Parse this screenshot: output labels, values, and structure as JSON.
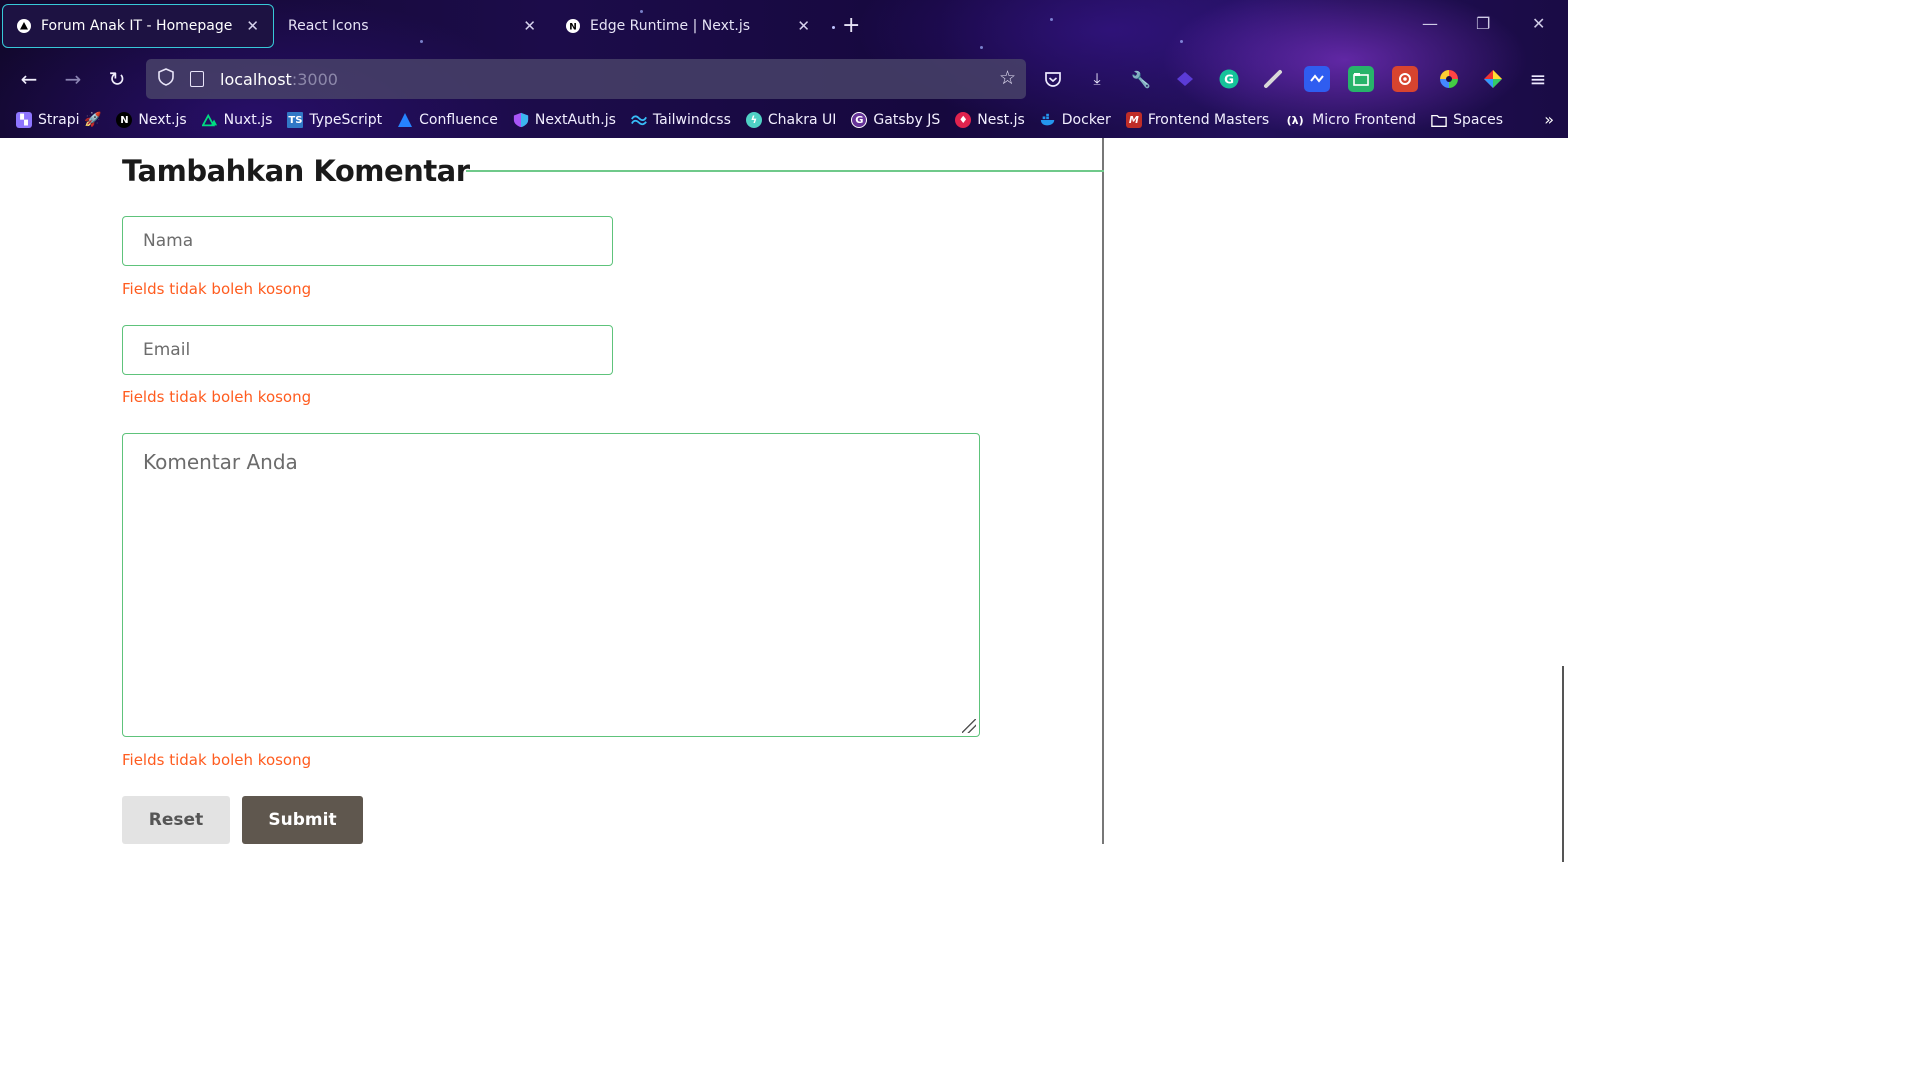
{
  "browser": {
    "tabs": [
      {
        "title": "Forum Anak IT - Homepage",
        "active": true,
        "icon": "vercel-triangle-icon"
      },
      {
        "title": "React Icons",
        "active": false,
        "icon": "none"
      },
      {
        "title": "Edge Runtime | Next.js",
        "active": false,
        "icon": "nextjs-icon"
      }
    ],
    "url_host": "localhost",
    "url_port": ":3000",
    "bookmarks": [
      {
        "label": "Strapi 🚀",
        "icon": "strapi-icon",
        "color": "#8e75ff"
      },
      {
        "label": "Next.js",
        "icon": "nextjs-icon",
        "color": "#000000"
      },
      {
        "label": "Nuxt.js",
        "icon": "nuxt-icon",
        "color": "#00dc82"
      },
      {
        "label": "TypeScript",
        "icon": "typescript-icon",
        "color": "#3178c6"
      },
      {
        "label": "Confluence",
        "icon": "confluence-icon",
        "color": "#2684ff"
      },
      {
        "label": "NextAuth.js",
        "icon": "nextauth-icon",
        "color": "#a855f7"
      },
      {
        "label": "Tailwindcss",
        "icon": "tailwind-icon",
        "color": "#38bdf8"
      },
      {
        "label": "Chakra UI",
        "icon": "chakra-icon",
        "color": "#319795"
      },
      {
        "label": "Gatsby JS",
        "icon": "gatsby-icon",
        "color": "#663399"
      },
      {
        "label": "Nest.js",
        "icon": "nestjs-icon",
        "color": "#e0234e"
      },
      {
        "label": "Docker",
        "icon": "docker-icon",
        "color": "#2496ed"
      },
      {
        "label": "Frontend Masters",
        "icon": "frontend-masters-icon",
        "color": "#c02d28"
      },
      {
        "label": "Micro Frontend",
        "icon": "lambda-icon",
        "color": "#ffffff"
      },
      {
        "label": "Spaces",
        "icon": "folder-icon",
        "color": "#ffffff"
      }
    ]
  },
  "form": {
    "title": "Tambahkan Komentar",
    "name_placeholder": "Nama",
    "email_placeholder": "Email",
    "comment_placeholder": "Komentar Anda",
    "error_name": "Fields tidak boleh kosong",
    "error_email": "Fields tidak boleh kosong",
    "error_comment": "Fields tidak boleh kosong",
    "reset_label": "Reset",
    "submit_label": "Submit"
  },
  "colors": {
    "accent_border": "#5ec37b",
    "error": "#ff5c1f",
    "submit_bg": "#5f574e",
    "reset_bg": "#e3e3e3"
  }
}
